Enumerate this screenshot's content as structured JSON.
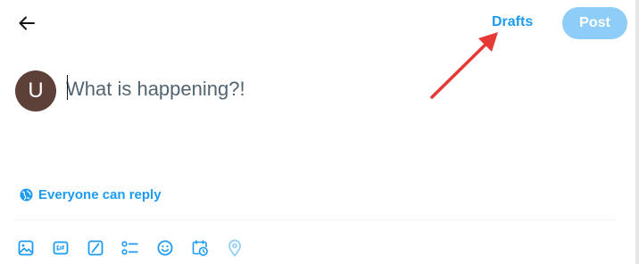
{
  "header": {
    "drafts_label": "Drafts",
    "post_label": "Post"
  },
  "composer": {
    "avatar_initial": "U",
    "placeholder": "What is happening?!",
    "value": ""
  },
  "reply_setting": {
    "label": "Everyone can reply",
    "icon": "globe-icon"
  },
  "toolbar": {
    "icons": [
      "image-icon",
      "gif-icon",
      "grok-icon",
      "poll-icon",
      "emoji-icon",
      "schedule-icon",
      "location-icon"
    ]
  },
  "annotation": {
    "color": "#e53935"
  },
  "colors": {
    "accent": "#1d9bf0",
    "post_disabled": "#8ecdf7",
    "avatar": "#5d4037"
  }
}
